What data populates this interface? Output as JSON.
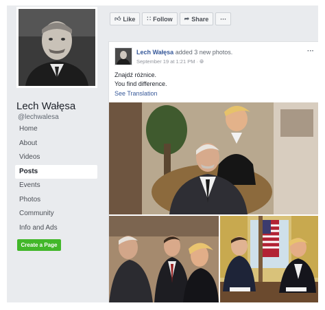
{
  "sidebar": {
    "page_name": "Lech Wałęsa",
    "page_handle": "@lechwalesa",
    "nav_items": [
      "Home",
      "About",
      "Videos",
      "Posts",
      "Events",
      "Photos",
      "Community",
      "Info and Ads"
    ],
    "active_item": "Posts",
    "create_page_label": "Create a Page"
  },
  "actions": {
    "like": "Like",
    "follow": "Follow",
    "share": "Share",
    "more": "···"
  },
  "post": {
    "author": "Lech Wałęsa",
    "action": " added 3 new photos.",
    "date": "September 19 at 1:21 PM · ",
    "menu": "···",
    "text_line1": "Znajdź różnice.",
    "text_line2": "You find difference.",
    "see_translation": "See Translation"
  },
  "icons": {
    "like": "thumbs-up-icon",
    "follow": "rss-icon",
    "share": "share-arrow-icon",
    "privacy": "globe-icon"
  },
  "colors": {
    "fb_link": "#365899",
    "create_page_green": "#42b72a",
    "background": "#e9ebee"
  }
}
